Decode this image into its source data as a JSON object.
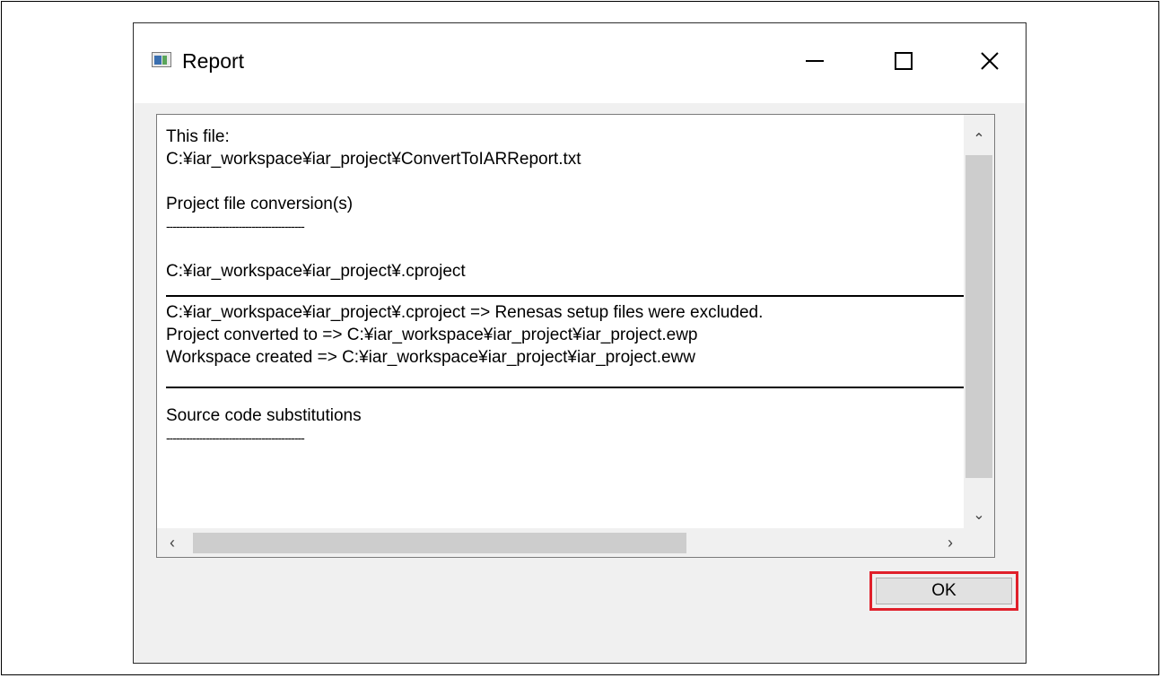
{
  "window": {
    "title": "Report",
    "app_icon": "window-app-icon",
    "controls": {
      "minimize": "minimize-icon",
      "maximize": "maximize-icon",
      "close": "close-icon",
      "close_glyph": "✕"
    }
  },
  "report": {
    "lines": [
      "This file:",
      "C:¥iar_workspace¥iar_project¥ConvertToIARReport.txt",
      "",
      "Project file conversion(s)",
      "------------------------------------------",
      "",
      "C:¥iar_workspace¥iar_project¥.cproject",
      "",
      "C:¥iar_workspace¥iar_project¥.cproject => Renesas setup files were excluded.",
      "Project converted to => C:¥iar_workspace¥iar_project¥iar_project.ewp",
      "Workspace created => C:¥iar_workspace¥iar_project¥iar_project.eww",
      "",
      "",
      "Source code substitutions",
      "------------------------------------------"
    ]
  },
  "scrollbars": {
    "up_glyph": "⌃",
    "down_glyph": "⌄",
    "left_glyph": "‹",
    "right_glyph": "›"
  },
  "buttons": {
    "ok_label": "OK"
  },
  "colors": {
    "highlight": "#e0202b",
    "window_bg": "#f0f0f0"
  }
}
